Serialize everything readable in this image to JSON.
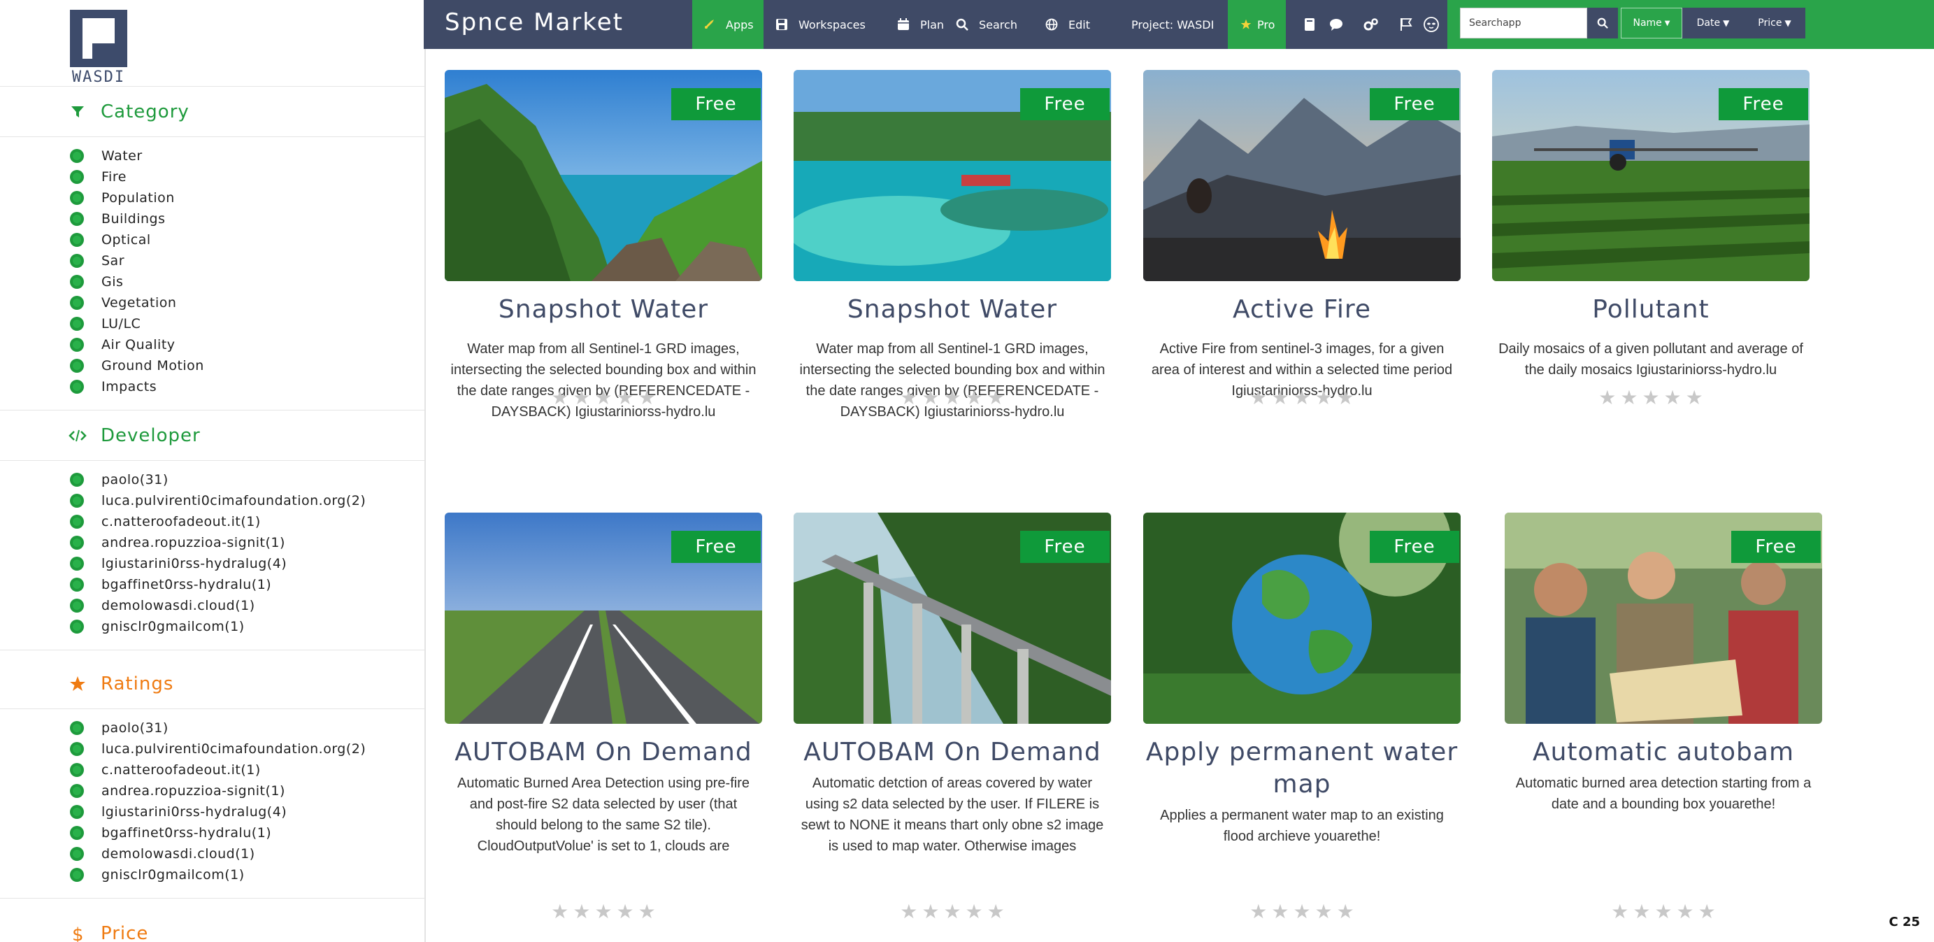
{
  "app": {
    "brand": "Spnce Market",
    "logo_text": "WASDI",
    "corner_tag": "C 25"
  },
  "nav": {
    "apps": "Apps",
    "workspaces": "Workspaces",
    "plan": "Plan",
    "search": "Search",
    "edit": "Edit",
    "project": "Project: WASDI",
    "pro": "Pro"
  },
  "toolbar": {
    "search_value": "Searchapp",
    "sort_name": "Name",
    "sort_date": "Date",
    "sort_price": "Price"
  },
  "sidebar": {
    "category_title": "Category",
    "categories": [
      "Water",
      "Fire",
      "Population",
      "Buildings",
      "Optical",
      "Sar",
      "Gis",
      "Vegetation",
      "LU/LC",
      "Air Quality",
      "Ground Motion",
      "Impacts"
    ],
    "developer_title": "Developer",
    "developers": [
      "paolo(31)",
      "luca.pulvirenti0cimafoundation.org(2)",
      "c.natteroofadeout.it(1)",
      "andrea.ropuzzioa-signit(1)",
      "lgiustarini0rss-hydralug(4)",
      "bgaffinet0rss-hydralu(1)",
      "demolowasdi.cloud(1)",
      "gnisclr0gmailcom(1)"
    ],
    "ratings_title": "Ratings",
    "ratings": [
      "paolo(31)",
      "luca.pulvirenti0cimafoundation.org(2)",
      "c.natteroofadeout.it(1)",
      "andrea.ropuzzioa-signit(1)",
      "lgiustarini0rss-hydralug(4)",
      "bgaffinet0rss-hydralu(1)",
      "demolowasdi.cloud(1)",
      "gnisclr0gmailcom(1)"
    ],
    "price_title": "Price"
  },
  "cards": [
    {
      "badge": "Free",
      "title": "Snapshot Water",
      "desc": "Water map from all Sentinel-1 GRD images, intersecting the selected bounding box and within the date ranges given by (REFERENCEDATE - DAYSBACK) Igiustariniorss-hydro.lu",
      "image": "coastal-cliffs"
    },
    {
      "badge": "Free",
      "title": "Snapshot Water",
      "desc": "Water map from all Sentinel-1 GRD images, intersecting the selected bounding box and within the date ranges given by (REFERENCEDATE - DAYSBACK) Igiustariniorss-hydro.lu",
      "image": "tropical-reef"
    },
    {
      "badge": "Free",
      "title": "Active Fire",
      "desc": "Active Fire from sentinel-3 images, for a given area of interest and within a selected time period Igiustariniorss-hydro.lu",
      "image": "campfire-mountains"
    },
    {
      "badge": "Free",
      "title": "Pollutant",
      "desc": "Daily mosaics of a given pollutant and average of the daily mosaics Igiustariniorss-hydro.lu",
      "image": "tractor-field"
    },
    {
      "badge": "Free",
      "title": "AUTOBAM On Demand",
      "desc": "Automatic Burned Area Detection using pre-fire and post-fire S2 data selected by user (that should belong to the same S2 tile). CloudOutputVolue' is set to 1, clouds are",
      "image": "highway"
    },
    {
      "badge": "Free",
      "title": "AUTOBAM On Demand",
      "desc": "Automatic detction of areas covered by water using s2 data selected by the user. If FILERE is sewt to NONE it means thart only obne s2 image is used to map water. Otherwise images",
      "image": "bridge"
    },
    {
      "badge": "Free",
      "title": "Apply permanent water map",
      "desc": "Applies a permanent water map to an existing flood archieve youarethe!",
      "image": "globe"
    },
    {
      "badge": "Free",
      "title": "Automatic autobam",
      "desc": "Automatic burned area detection starting from a date and a bounding box youarethe!",
      "image": "people-map"
    }
  ]
}
